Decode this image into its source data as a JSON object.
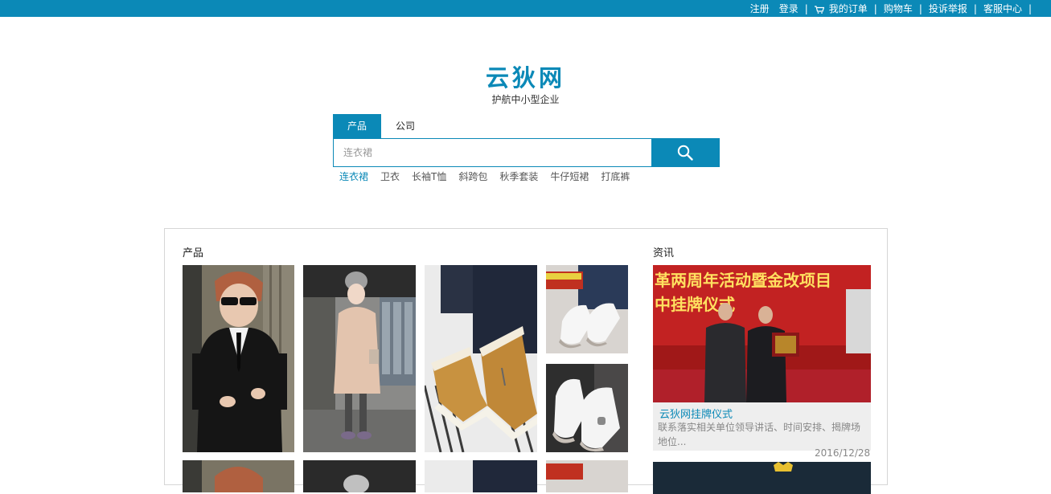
{
  "topnav": {
    "register": "注册",
    "login": "登录",
    "sep": "|",
    "my_orders": "我的订单",
    "cart": "购物车",
    "complaint": "投诉举报",
    "service": "客服中心"
  },
  "brand": {
    "logo": "云狄网",
    "slogan": "护航中小型企业"
  },
  "search": {
    "tabs": [
      "产品",
      "公司"
    ],
    "active_tab": "产品",
    "placeholder": "连衣裙",
    "hotwords": [
      "连衣裙",
      "卫衣",
      "长袖T恤",
      "斜跨包",
      "秋季套装",
      "牛仔短裙",
      "打底裤"
    ]
  },
  "products": {
    "title": "产品"
  },
  "news": {
    "title": "资讯",
    "banner_lines": [
      "革两周年活动暨金改项目",
      "中挂牌仪式"
    ],
    "item_title": "云狄网挂牌仪式",
    "item_desc": "联系落实相关单位领导讲话、时间安排、揭牌场地位...",
    "item_date": "2016/12/28"
  },
  "colors": {
    "accent": "#0b89b7",
    "topbar": "#0b89b7"
  }
}
